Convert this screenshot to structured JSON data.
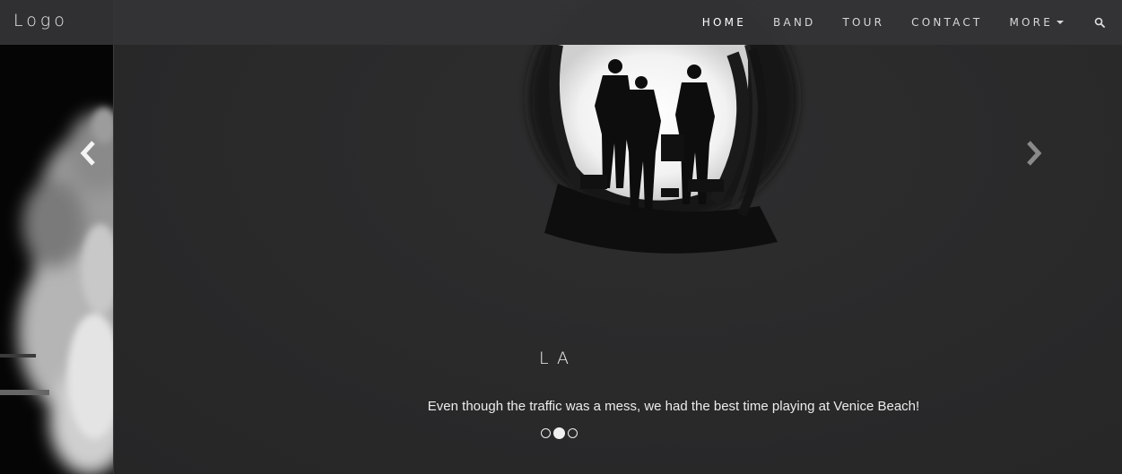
{
  "navbar": {
    "logo": "Logo",
    "items": [
      {
        "label": "HOME",
        "active": true
      },
      {
        "label": "BAND",
        "active": false
      },
      {
        "label": "TOUR",
        "active": false
      },
      {
        "label": "CONTACT",
        "active": false
      },
      {
        "label": "MORE",
        "active": false
      }
    ],
    "search_icon": "search-icon"
  },
  "carousel": {
    "caption_title": "LA",
    "caption_text": "Even though the traffic was a mess, we had the best time playing at Venice Beach!",
    "indicator_count": 3,
    "active_index": 1,
    "prev_icon": "chevron-left-icon",
    "next_icon": "chevron-right-icon"
  },
  "colors": {
    "navbar_bg": "#343436",
    "slide_bg": "#2b2b2c",
    "text": "#f2f2f2"
  }
}
